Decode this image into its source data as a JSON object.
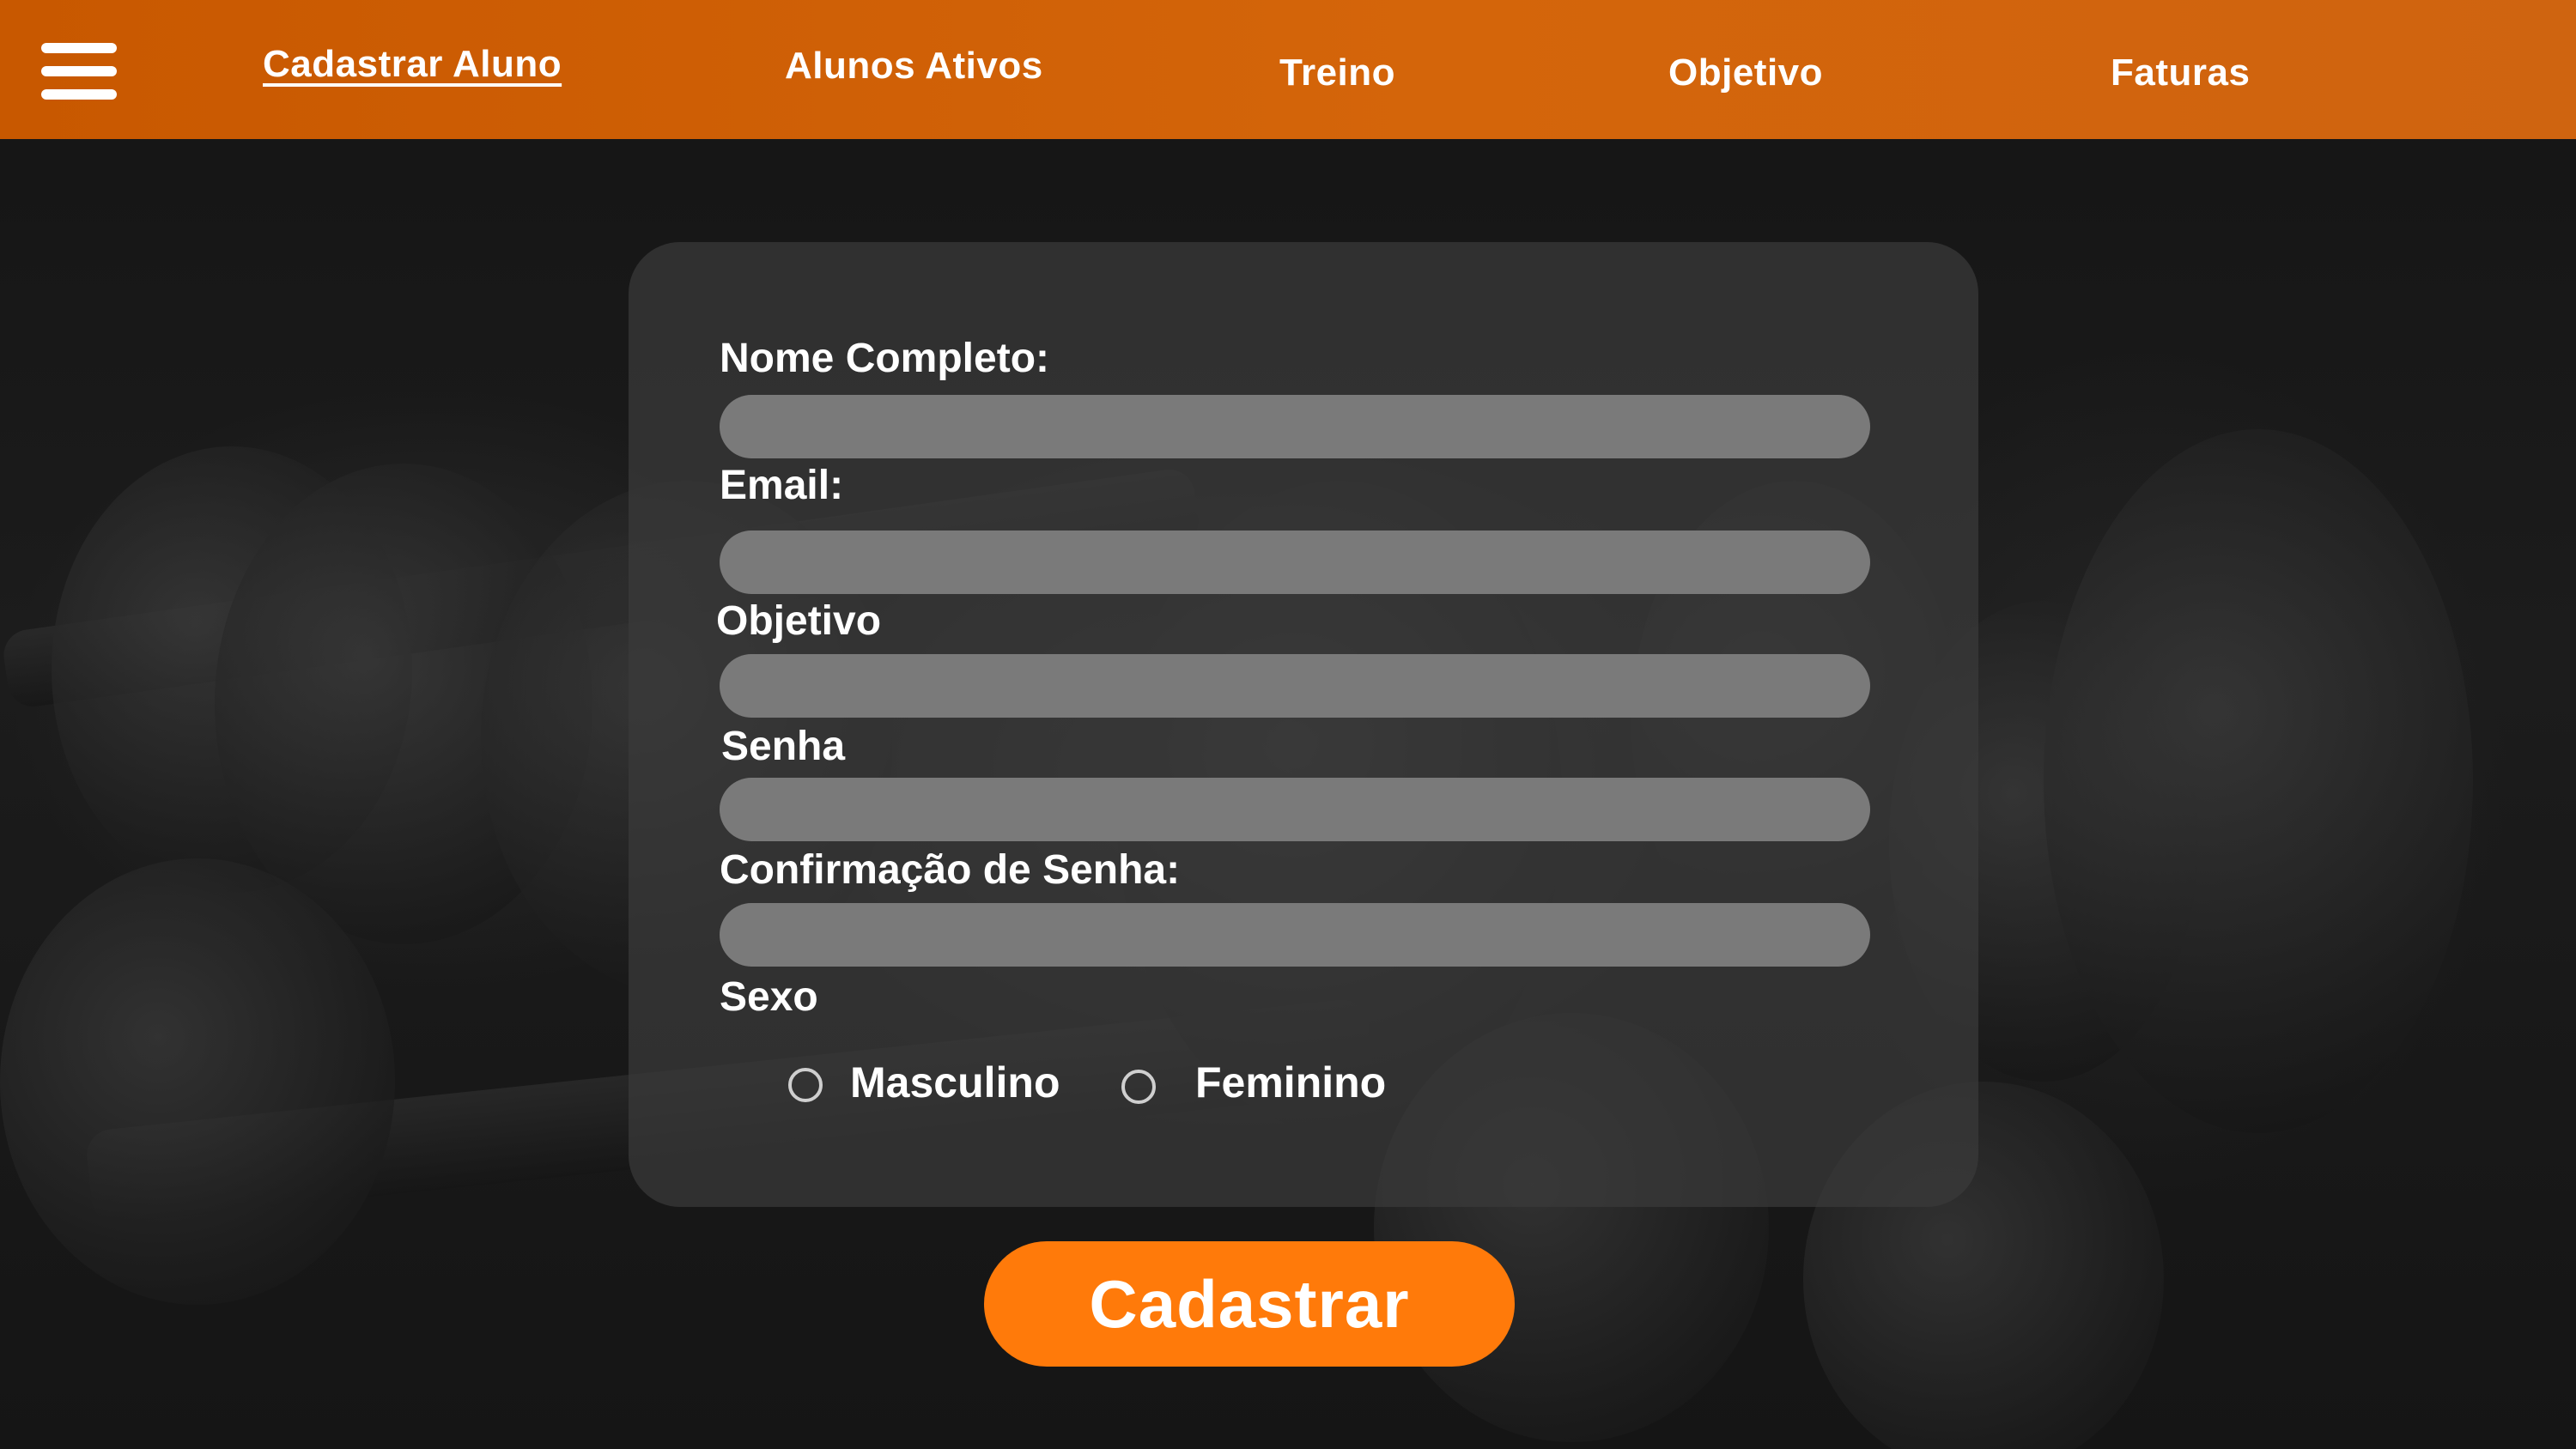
{
  "nav": {
    "items": [
      {
        "label": "Cadastrar Aluno",
        "active": true
      },
      {
        "label": "Alunos Ativos",
        "active": false
      },
      {
        "label": "Treino",
        "active": false
      },
      {
        "label": "Objetivo",
        "active": false
      },
      {
        "label": "Faturas",
        "active": false
      }
    ],
    "menu_icon": "hamburger-menu-icon"
  },
  "form": {
    "fields": [
      {
        "label": "Nome Completo:",
        "value": ""
      },
      {
        "label": "Email:",
        "value": ""
      },
      {
        "label": "Objetivo",
        "value": ""
      },
      {
        "label": "Senha",
        "value": ""
      },
      {
        "label": "Confirmação de Senha:",
        "value": ""
      }
    ],
    "sexo": {
      "label": "Sexo",
      "options": [
        {
          "label": "Masculino",
          "checked": false
        },
        {
          "label": "Feminino",
          "checked": false
        }
      ]
    },
    "submit_label": "Cadastrar"
  },
  "colors": {
    "header": "#d4650a",
    "button": "#ff7a0a",
    "panel": "#3a3a3a",
    "input": "#7a7a7a"
  }
}
